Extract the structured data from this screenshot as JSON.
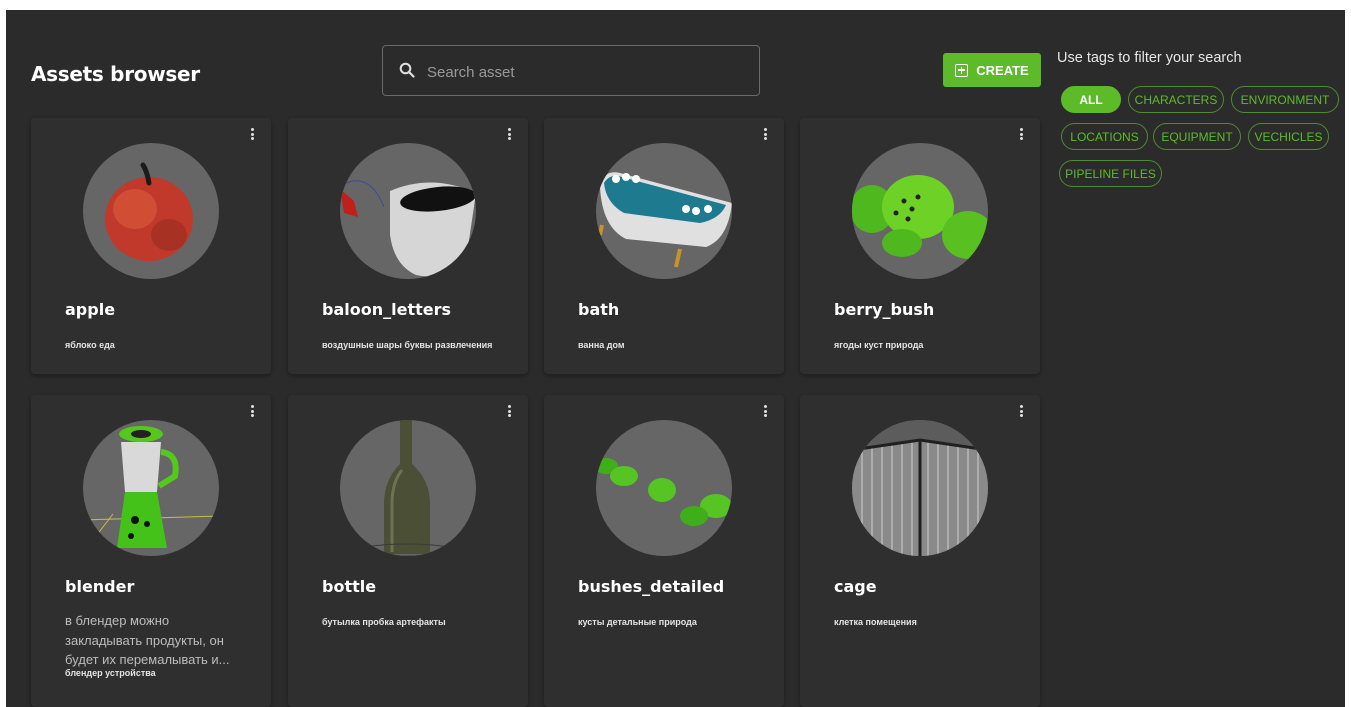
{
  "header": {
    "title": "Assets browser",
    "search_placeholder": "Search asset",
    "create_label": "CREATE"
  },
  "filters": {
    "title": "Use tags to filter your search",
    "tags": [
      "ALL",
      "CHARACTERS",
      "ENVIRONMENT",
      "LOCATIONS",
      "EQUIPMENT",
      "VECHICLES",
      "PIPELINE FILES"
    ],
    "active": "ALL"
  },
  "colors": {
    "accent": "#5dbb2a",
    "background": "#2b2b2b",
    "card": "#2f2f2f"
  },
  "assets": [
    {
      "name": "apple",
      "tags": "яблоко еда",
      "icon": "apple-icon"
    },
    {
      "name": "baloon_letters",
      "tags": "воздушные шары буквы развлечения",
      "icon": "baloon-letters-icon"
    },
    {
      "name": "bath",
      "tags": "ванна дом",
      "icon": "bath-icon"
    },
    {
      "name": "berry_bush",
      "tags": "ягоды куст природа",
      "icon": "berry-bush-icon"
    },
    {
      "name": "blender",
      "description": "в блендер можно закладывать продукты, он будет их перемалывать и...",
      "tags": "блендер устройства",
      "icon": "blender-icon"
    },
    {
      "name": "bottle",
      "tags": "бутылка пробка артефакты",
      "icon": "bottle-icon"
    },
    {
      "name": "bushes_detailed",
      "tags": "кусты детальные природа",
      "icon": "bushes-icon"
    },
    {
      "name": "cage",
      "tags": "клетка помещения",
      "icon": "cage-icon"
    }
  ]
}
